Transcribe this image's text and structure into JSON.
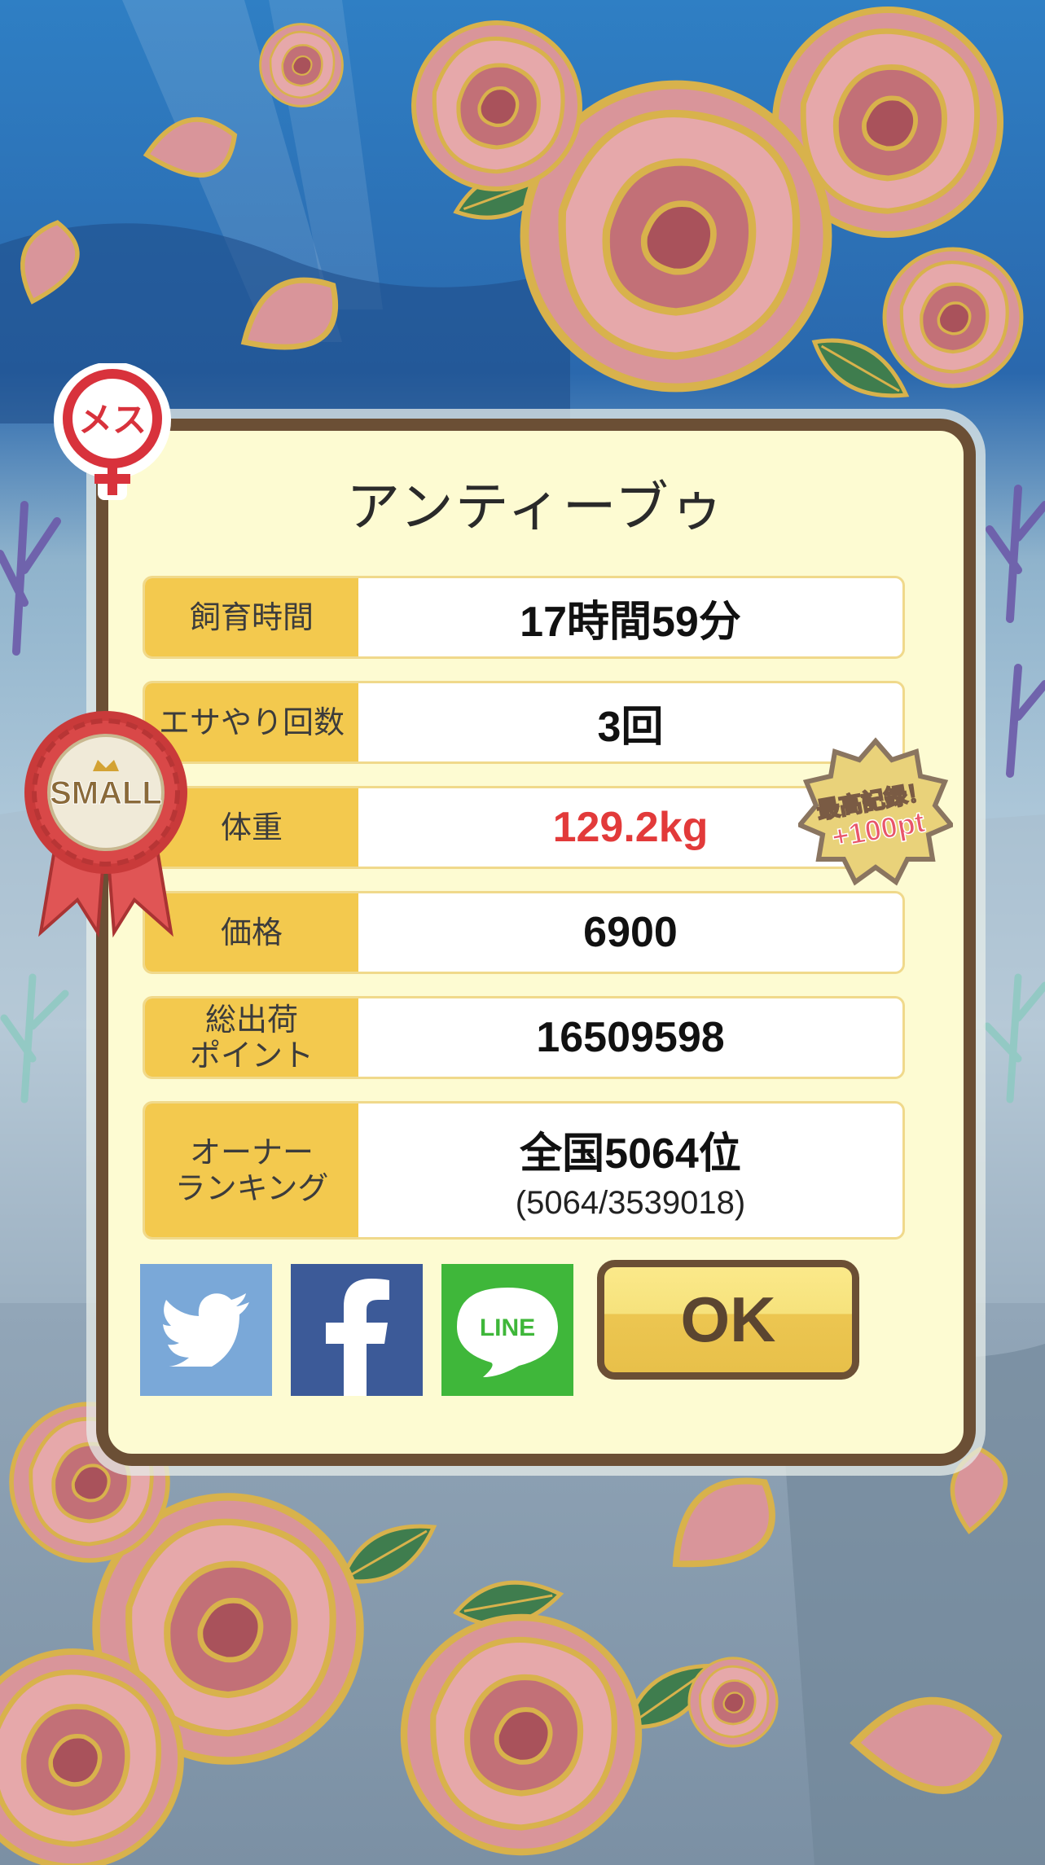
{
  "fish_name": "アンティーブゥ",
  "gender_badge": "メス",
  "size_badge": "SMALL",
  "record_badge": {
    "line1": "最高記録！",
    "line2": "+100pt"
  },
  "stats": [
    {
      "label": "飼育時間",
      "value": "17時間59分"
    },
    {
      "label": "エサやり回数",
      "value": "3回"
    },
    {
      "label": "体重",
      "value": "129.2kg",
      "highlight_color": "#e23a3a"
    },
    {
      "label": "価格",
      "value": "6900"
    },
    {
      "label_line1": "総出荷",
      "label_line2": "ポイント",
      "value": "16509598"
    },
    {
      "label_line1": "オーナー",
      "label_line2": "ランキング",
      "value": "全国5064位",
      "subvalue": "(5064/3539018)"
    }
  ],
  "share": {
    "twitter_icon": "twitter-bird-icon",
    "facebook_icon": "facebook-f-icon",
    "line_text": "LINE"
  },
  "ok_label": "OK",
  "colors": {
    "dialog_bg": "#fdfbd2",
    "dialog_border": "#6b4f35",
    "label_bg": "#f3c94e",
    "rose_pink": "#d9959a",
    "rose_dark": "#b2626a",
    "rose_outline": "#d8b24c"
  }
}
